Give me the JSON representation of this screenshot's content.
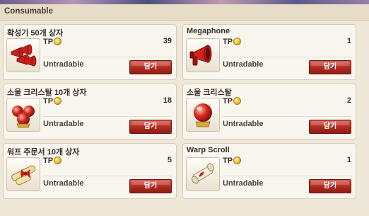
{
  "header": {
    "title": "Consumable"
  },
  "items": [
    {
      "name": "확성기 50개 상자",
      "tp_label": "TP",
      "qty": "39",
      "trade": "Untradable",
      "button": "담기",
      "icon": "megaphone-box-icon"
    },
    {
      "name": "Megaphone",
      "tp_label": "TP",
      "qty": "1",
      "trade": "Untradable",
      "button": "담기",
      "icon": "megaphone-icon"
    },
    {
      "name": "소울 크리스탈 10개 상자",
      "tp_label": "TP",
      "qty": "18",
      "trade": "Untradable",
      "button": "담기",
      "icon": "soul-crystal-box-icon"
    },
    {
      "name": "소울 크리스탈",
      "tp_label": "TP",
      "qty": "2",
      "trade": "Untradable",
      "button": "담기",
      "icon": "soul-crystal-icon"
    },
    {
      "name": "워프 주문서 10개 상자",
      "tp_label": "TP",
      "qty": "5",
      "trade": "Untradable",
      "button": "담기",
      "icon": "warp-scroll-box-icon"
    },
    {
      "name": "Warp Scroll",
      "tp_label": "TP",
      "qty": "1",
      "trade": "Untradable",
      "button": "담기",
      "icon": "warp-scroll-icon"
    }
  ],
  "colors": {
    "button": "#b02a20",
    "background": "#efe8d8",
    "card": "#f9f6ef"
  }
}
